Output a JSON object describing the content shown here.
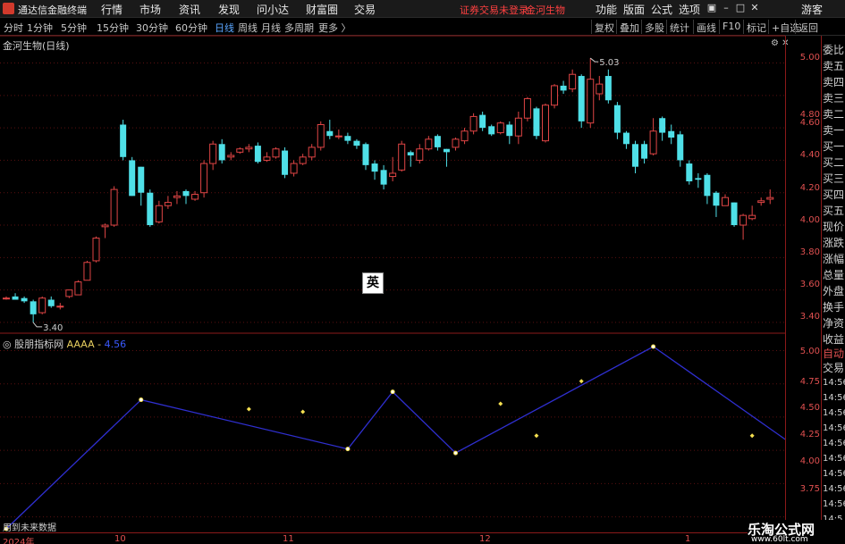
{
  "titlebar": {
    "app_name": "通达信金融终端",
    "menus": [
      "行情",
      "市场",
      "资讯",
      "发现",
      "问小达",
      "财富圈",
      "交易"
    ],
    "status": "证券交易未登录",
    "stock": "金河生物",
    "right_menus": [
      "功能",
      "版面",
      "公式",
      "选项"
    ],
    "guest": "游客"
  },
  "periodbar": {
    "periods": [
      "分时",
      "1分钟",
      "5分钟",
      "15分钟",
      "30分钟",
      "60分钟",
      "日线",
      "周线",
      "月线",
      "多周期",
      "更多 〉"
    ],
    "active": "日线",
    "tools": [
      "复权",
      "叠加",
      "多股",
      "统计",
      "画线",
      "F10",
      "标记",
      "+自选",
      "返回"
    ]
  },
  "main_chart": {
    "label": "金河生物(日线)",
    "high_label": "5.03",
    "low_label": "3.40",
    "y_ticks": [
      "5.00",
      "4.80",
      "4.60",
      "4.40",
      "4.20",
      "4.00",
      "3.80",
      "3.60",
      "3.40"
    ]
  },
  "indicator": {
    "name": "股朋指标网",
    "series_name": "AAAA -",
    "series_value": "4.56",
    "y_ticks": [
      "5.00",
      "4.75",
      "4.50",
      "4.25",
      "4.00",
      "3.75"
    ],
    "footnote": "用到未来数据"
  },
  "ime": "英",
  "x_ticks": [
    "2024年",
    "10",
    "11",
    "12",
    "1"
  ],
  "quote_panel": {
    "rows": [
      "委比",
      "卖五",
      "卖四",
      "卖三",
      "卖二",
      "卖一",
      "买一",
      "买二",
      "买三",
      "买四",
      "买五",
      "现价",
      "涨跌",
      "涨幅",
      "总量",
      "外盘",
      "换手",
      "净资",
      "收益"
    ],
    "auto": "自动",
    "trade": "交易",
    "times": [
      "14:56",
      "14:56",
      "14:56",
      "14:56",
      "14:56",
      "14:56",
      "14:56",
      "14:56",
      "14:56",
      "14:5"
    ]
  },
  "watermark": {
    "title": "乐淘公式网",
    "url": "www.60lt.com"
  },
  "colors": {
    "up": "#e04545",
    "down": "#4fe0e8",
    "indicator_line": "#2f2fd0",
    "dot": "#f5e050",
    "frame": "#8b1a1a"
  },
  "chart_data": {
    "type": "candlestick",
    "title": "金河生物(日线)",
    "y_range": [
      3.35,
      5.08
    ],
    "candles": [
      [
        3.55,
        3.55,
        3.56,
        3.54
      ],
      [
        3.56,
        3.54,
        3.58,
        3.54
      ],
      [
        3.55,
        3.53,
        3.56,
        3.52
      ],
      [
        3.53,
        3.45,
        3.54,
        3.4
      ],
      [
        3.46,
        3.55,
        3.56,
        3.45
      ],
      [
        3.54,
        3.5,
        3.56,
        3.49
      ],
      [
        3.5,
        3.5,
        3.52,
        3.48
      ],
      [
        3.56,
        3.6,
        3.6,
        3.55
      ],
      [
        3.57,
        3.65,
        3.66,
        3.57
      ],
      [
        3.66,
        3.77,
        3.78,
        3.66
      ],
      [
        3.78,
        3.92,
        3.93,
        3.77
      ],
      [
        3.99,
        4.0,
        4.01,
        3.92
      ],
      [
        4.0,
        4.22,
        4.24,
        3.99
      ],
      [
        4.62,
        4.42,
        4.65,
        4.4
      ],
      [
        4.4,
        4.18,
        4.42,
        4.18
      ],
      [
        4.36,
        4.2,
        4.36,
        4.12
      ],
      [
        4.2,
        4.0,
        4.22,
        3.99
      ],
      [
        4.02,
        4.12,
        4.15,
        4.01
      ],
      [
        4.12,
        4.14,
        4.18,
        4.1
      ],
      [
        4.17,
        4.18,
        4.21,
        4.13
      ],
      [
        4.21,
        4.18,
        4.22,
        4.13
      ],
      [
        4.16,
        4.19,
        4.21,
        4.15
      ],
      [
        4.2,
        4.38,
        4.4,
        4.17
      ],
      [
        4.38,
        4.5,
        4.52,
        4.34
      ],
      [
        4.5,
        4.4,
        4.53,
        4.38
      ],
      [
        4.42,
        4.43,
        4.45,
        4.4
      ],
      [
        4.45,
        4.47,
        4.48,
        4.44
      ],
      [
        4.47,
        4.48,
        4.5,
        4.45
      ],
      [
        4.49,
        4.39,
        4.51,
        4.38
      ],
      [
        4.4,
        4.42,
        4.45,
        4.39
      ],
      [
        4.42,
        4.47,
        4.48,
        4.41
      ],
      [
        4.46,
        4.31,
        4.48,
        4.29
      ],
      [
        4.32,
        4.38,
        4.4,
        4.3
      ],
      [
        4.38,
        4.42,
        4.44,
        4.37
      ],
      [
        4.42,
        4.48,
        4.5,
        4.4
      ],
      [
        4.48,
        4.62,
        4.64,
        4.46
      ],
      [
        4.58,
        4.55,
        4.65,
        4.53
      ],
      [
        4.55,
        4.55,
        4.59,
        4.53
      ],
      [
        4.55,
        4.52,
        4.57,
        4.5
      ],
      [
        4.52,
        4.49,
        4.53,
        4.47
      ],
      [
        4.5,
        4.37,
        4.51,
        4.34
      ],
      [
        4.38,
        4.33,
        4.4,
        4.28
      ],
      [
        4.34,
        4.25,
        4.37,
        4.22
      ],
      [
        4.3,
        4.32,
        4.42,
        4.27
      ],
      [
        4.34,
        4.5,
        4.52,
        4.33
      ],
      [
        4.45,
        4.43,
        4.46,
        4.36
      ],
      [
        4.4,
        4.47,
        4.5,
        4.38
      ],
      [
        4.47,
        4.53,
        4.55,
        4.46
      ],
      [
        4.55,
        4.48,
        4.56,
        4.46
      ],
      [
        4.47,
        4.45,
        4.47,
        4.36
      ],
      [
        4.48,
        4.53,
        4.54,
        4.46
      ],
      [
        4.52,
        4.58,
        4.6,
        4.5
      ],
      [
        4.58,
        4.67,
        4.69,
        4.56
      ],
      [
        4.68,
        4.6,
        4.7,
        4.58
      ],
      [
        4.61,
        4.56,
        4.62,
        4.55
      ],
      [
        4.57,
        4.63,
        4.64,
        4.56
      ],
      [
        4.62,
        4.55,
        4.64,
        4.5
      ],
      [
        4.55,
        4.66,
        4.7,
        4.5
      ],
      [
        4.66,
        4.78,
        4.79,
        4.64
      ],
      [
        4.72,
        4.55,
        4.73,
        4.53
      ],
      [
        4.52,
        4.74,
        4.75,
        4.51
      ],
      [
        4.74,
        4.86,
        4.87,
        4.72
      ],
      [
        4.86,
        4.83,
        4.89,
        4.81
      ],
      [
        4.84,
        4.93,
        4.96,
        4.82
      ],
      [
        4.92,
        4.64,
        4.93,
        4.6
      ],
      [
        4.63,
        4.9,
        5.03,
        4.6
      ],
      [
        4.81,
        4.87,
        4.92,
        4.77
      ],
      [
        4.92,
        4.77,
        4.96,
        4.75
      ],
      [
        4.74,
        4.57,
        4.76,
        4.53
      ],
      [
        4.57,
        4.5,
        4.58,
        4.47
      ],
      [
        4.5,
        4.36,
        4.52,
        4.32
      ],
      [
        4.5,
        4.41,
        4.52,
        4.38
      ],
      [
        4.44,
        4.58,
        4.66,
        4.43
      ],
      [
        4.66,
        4.57,
        4.67,
        4.52
      ],
      [
        4.58,
        4.54,
        4.62,
        4.5
      ],
      [
        4.56,
        4.4,
        4.58,
        4.36
      ],
      [
        4.38,
        4.27,
        4.4,
        4.25
      ],
      [
        4.29,
        4.28,
        4.32,
        4.23
      ],
      [
        4.31,
        4.18,
        4.32,
        4.13
      ],
      [
        4.2,
        4.12,
        4.21,
        4.05
      ],
      [
        4.12,
        4.17,
        4.19,
        4.12
      ],
      [
        4.14,
        4.0,
        4.14,
        3.99
      ],
      [
        4.0,
        4.06,
        4.07,
        3.91
      ],
      [
        4.04,
        4.06,
        4.12,
        4.03
      ],
      [
        4.14,
        4.15,
        4.17,
        4.12
      ],
      [
        4.16,
        4.17,
        4.22,
        4.13
      ]
    ],
    "indicator": {
      "name": "AAAA",
      "y_range": [
        3.66,
        5.03
      ],
      "line": [
        [
          0,
          3.66
        ],
        [
          15,
          4.63
        ],
        [
          38,
          4.26
        ],
        [
          43,
          4.69
        ],
        [
          50,
          4.23
        ],
        [
          72,
          5.03
        ],
        [
          96,
          3.89
        ],
        [
          102,
          4.55
        ]
      ],
      "dots": [
        [
          27,
          4.56
        ],
        [
          33,
          4.54
        ],
        [
          55,
          4.6
        ],
        [
          59,
          4.36
        ],
        [
          64,
          4.77
        ],
        [
          83,
          4.36
        ]
      ]
    }
  }
}
